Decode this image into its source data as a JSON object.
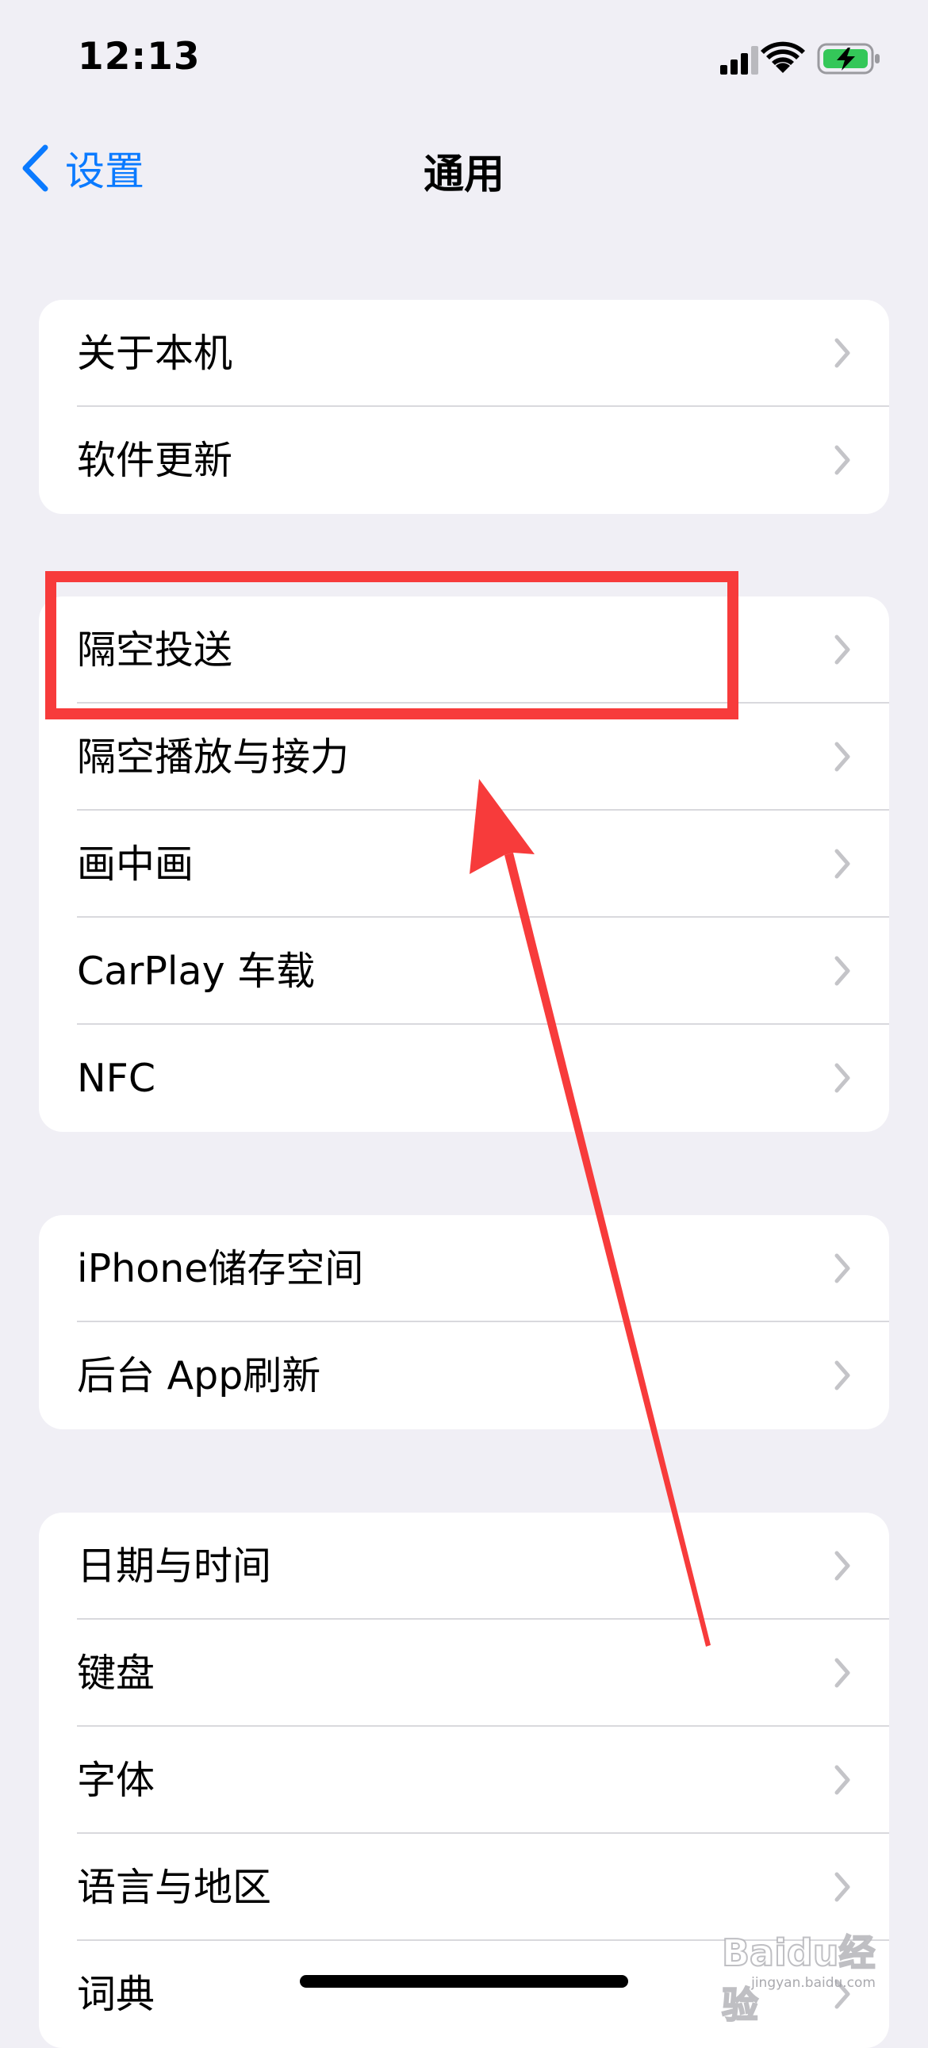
{
  "status_bar": {
    "time": "12:13"
  },
  "nav": {
    "back_label": "设置",
    "title": "通用"
  },
  "groups": [
    {
      "items": [
        "关于本机",
        "软件更新"
      ]
    },
    {
      "items": [
        "隔空投送",
        "隔空播放与接力",
        "画中画",
        "CarPlay 车载",
        "NFC"
      ]
    },
    {
      "items": [
        "iPhone储存空间",
        "后台 App刷新"
      ]
    },
    {
      "items": [
        "日期与时间",
        "键盘",
        "字体",
        "语言与地区",
        "词典"
      ]
    }
  ],
  "annotation": {
    "highlight_color": "#f73b3b"
  },
  "watermark": {
    "text": "Baidu经验",
    "sub": "jingyan.baidu.com"
  },
  "colors": {
    "accent": "#0a7aff",
    "background": "#f0eff5",
    "chevron": "#c4c4c8"
  }
}
